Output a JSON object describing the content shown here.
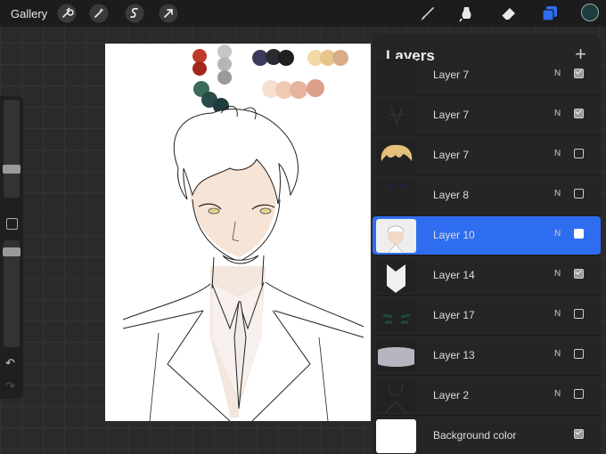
{
  "topbar": {
    "gallery_label": "Gallery",
    "tools": [
      "wrench-icon",
      "magic-wand-icon",
      "selection-icon",
      "transform-icon",
      "brush-icon",
      "smudge-icon",
      "eraser-icon",
      "layers-icon"
    ],
    "current_color": "#1e3b3d",
    "accent": "#2f6df0"
  },
  "layers_panel": {
    "title": "Layers",
    "add_icon": "plus-icon",
    "layers": [
      {
        "name": "Layer 7",
        "blend": "N",
        "visible": true
      },
      {
        "name": "Layer 7",
        "blend": "N",
        "visible": true
      },
      {
        "name": "Layer 7",
        "blend": "N",
        "visible": false
      },
      {
        "name": "Layer 8",
        "blend": "N",
        "visible": false
      },
      {
        "name": "Layer 10",
        "blend": "N",
        "visible": true
      },
      {
        "name": "Layer 14",
        "blend": "N",
        "visible": true
      },
      {
        "name": "Layer 17",
        "blend": "N",
        "visible": false
      },
      {
        "name": "Layer 13",
        "blend": "N",
        "visible": false
      },
      {
        "name": "Layer 2",
        "blend": "N",
        "visible": false
      }
    ],
    "background": {
      "name": "Background color",
      "color": "#ffffff",
      "visible": true
    }
  },
  "palette_swatches": [
    "#c0392b",
    "#a0281e",
    "#c8c4c8",
    "#b8b4b8",
    "#9c989c",
    "#3c3a5a",
    "#2a2a30",
    "#202020",
    "#f2d9a8",
    "#e6c68a",
    "#d9ad88",
    "#f7e0d0",
    "#f0cbb4",
    "#e6b49c",
    "#dca08a",
    "#3a6a5a",
    "#2a4a48",
    "#1e3b3d"
  ]
}
